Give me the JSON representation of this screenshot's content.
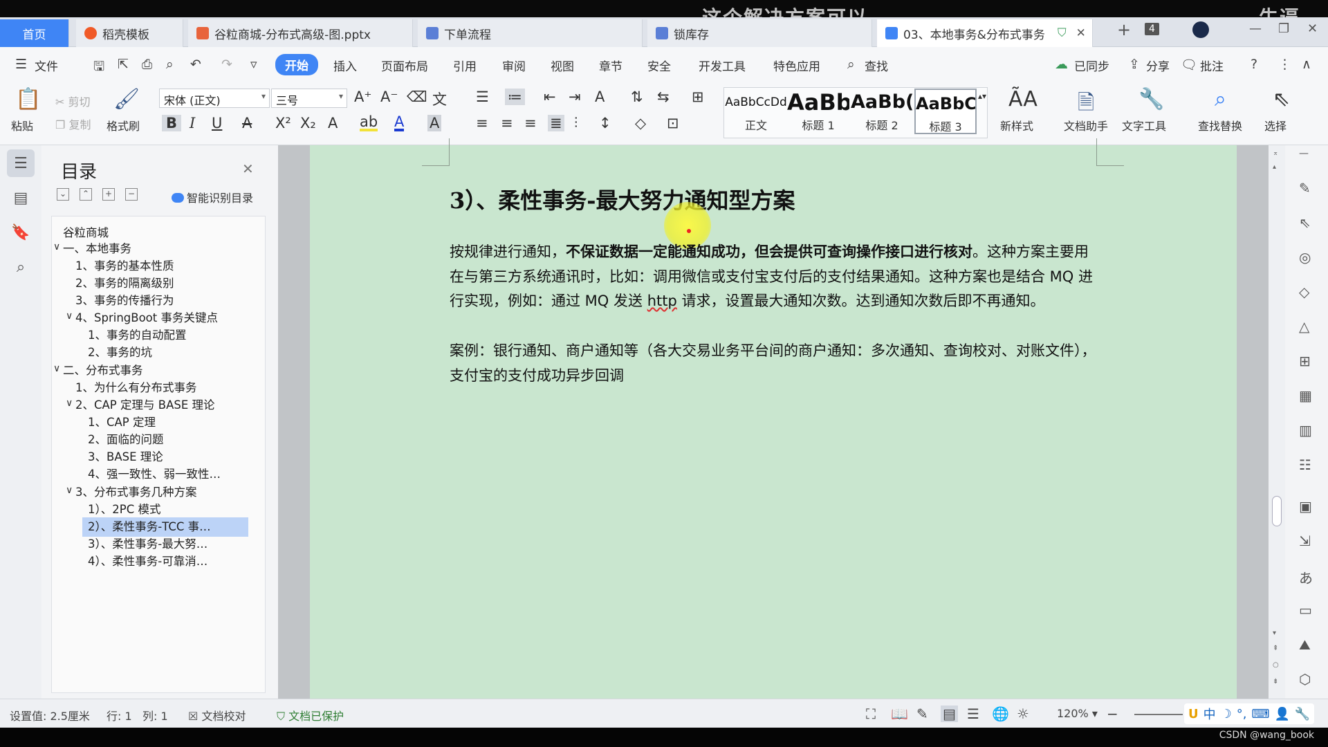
{
  "overlays": {
    "subtitle": "这个解决方案可以",
    "top_right": "牛逼"
  },
  "tabs": [
    {
      "label": "首页"
    },
    {
      "label": "稻壳模板"
    },
    {
      "label": "谷粒商城-分布式高级-图.pptx"
    },
    {
      "label": "下单流程"
    },
    {
      "label": "锁库存"
    },
    {
      "label": "03、本地事务&分布式事务"
    }
  ],
  "tab_count": "4",
  "window_controls": {
    "minimize": "—",
    "restore": "❐",
    "close": "✕",
    "new_tab": "+"
  },
  "menu": {
    "file": "文件",
    "items": [
      "开始",
      "插入",
      "页面布局",
      "引用",
      "审阅",
      "视图",
      "章节",
      "安全",
      "开发工具",
      "特色应用"
    ],
    "search": "查找",
    "synced": "已同步",
    "share": "分享",
    "comment": "批注"
  },
  "ribbon": {
    "paste": "粘贴",
    "cut": "剪切",
    "copy": "复制",
    "format_painter": "格式刷",
    "font_name": "宋体 (正文)",
    "font_size": "三号",
    "styles": [
      {
        "sample": "AaBbCcDd",
        "name": "正文"
      },
      {
        "sample": "AaBb",
        "name": "标题 1"
      },
      {
        "sample": "AaBb(",
        "name": "标题 2"
      },
      {
        "sample": "AaBbC(",
        "name": "标题 3"
      }
    ],
    "new_style": "新样式",
    "doc_assistant": "文档助手",
    "text_tools": "文字工具",
    "find_replace": "查找替换",
    "select": "选择"
  },
  "toc": {
    "title": "目录",
    "smart_label": "智能识别目录",
    "items": [
      {
        "text": "谷粒商城"
      },
      {
        "text": "一、本地事务"
      },
      {
        "text": "1、事务的基本性质"
      },
      {
        "text": "2、事务的隔离级别"
      },
      {
        "text": "3、事务的传播行为"
      },
      {
        "text": "4、SpringBoot 事务关键点"
      },
      {
        "text": "1、事务的自动配置"
      },
      {
        "text": "2、事务的坑"
      },
      {
        "text": "二、分布式事务"
      },
      {
        "text": "1、为什么有分布式事务"
      },
      {
        "text": "2、CAP 定理与 BASE 理论"
      },
      {
        "text": "1、CAP 定理"
      },
      {
        "text": "2、面临的问题"
      },
      {
        "text": "3、BASE 理论"
      },
      {
        "text": "4、强一致性、弱一致性…"
      },
      {
        "text": "3、分布式事务几种方案"
      },
      {
        "text": "1）、2PC 模式"
      },
      {
        "text": "2）、柔性事务-TCC 事…"
      },
      {
        "text": "3）、柔性事务-最大努…"
      },
      {
        "text": "4）、柔性事务-可靠消…"
      }
    ]
  },
  "document": {
    "heading": "3）、柔性事务-最大努力通知型方案",
    "p1_lead": "按规律进行通知，",
    "p1_bold": "不保证数据一定能通知成功，但会提供可查询操作接口进行核对",
    "p1_rest": "。这种方案主要用在与第三方系统通讯时，比如：调用微信或支付宝支付后的支付结果通知。这种方案也是结合 MQ 进行实现，例如：通过 MQ 发送 ",
    "p1_http": "http",
    "p1_end": " 请求，设置最大通知次数。达到通知次数后即不再通知。",
    "p2": "案例：银行通知、商户通知等（各大交易业务平台间的商户通知：多次通知、查询校对、对账文件），支付宝的支付成功异步回调"
  },
  "status": {
    "setting": "设置值: 2.5厘米",
    "row": "行: 1",
    "col": "列: 1",
    "proof": "文档校对",
    "protected": "文档已保护",
    "zoom": "120%",
    "ime": [
      "中",
      "☽",
      "°,",
      "⌨",
      "👤",
      "🔧"
    ]
  },
  "watermark": "CSDN @wang_book",
  "colors": {
    "accent": "#3f85f5",
    "page_bg": "#c9e6cf",
    "toc_highlight": "#bcd3f7"
  }
}
